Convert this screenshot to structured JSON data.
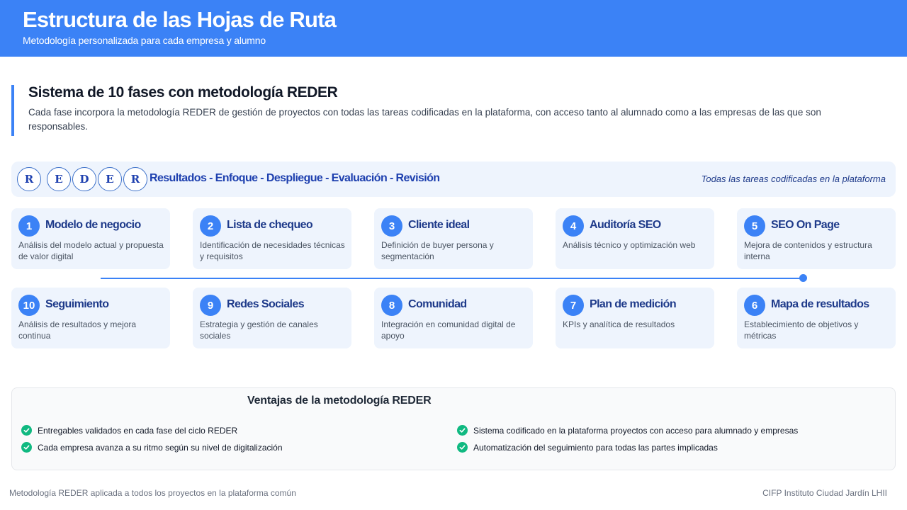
{
  "header": {
    "title": "Estructura de las Hojas de Ruta",
    "subtitle": "Metodología personalizada para cada empresa y alumno"
  },
  "intro": {
    "title": "Sistema de 10 fases con metodología REDER",
    "text": "Cada fase incorpora la metodología REDER de gestión de proyectos con todas las tareas codificadas en la plataforma, con acceso tanto al alumnado como a las empresas de las que son responsables."
  },
  "reder": {
    "letters": [
      "R",
      "E",
      "D",
      "E",
      "R"
    ],
    "label": "Resultados - Enfoque - Despliegue - Evaluación - Revisión",
    "note": "Todas las tareas codificadas en la plataforma"
  },
  "phases": [
    {
      "num": "1",
      "title": "Modelo de negocio",
      "desc": "Análisis del modelo actual y propuesta de valor digital"
    },
    {
      "num": "2",
      "title": "Lista de chequeo",
      "desc": "Identificación de necesidades técnicas y requisitos"
    },
    {
      "num": "3",
      "title": "Cliente ideal",
      "desc": "Definición de buyer persona y segmentación"
    },
    {
      "num": "4",
      "title": "Auditoría SEO",
      "desc": "Análisis técnico y optimización web"
    },
    {
      "num": "5",
      "title": "SEO On Page",
      "desc": "Mejora de contenidos y estructura interna"
    },
    {
      "num": "6",
      "title": "Mapa de resultados",
      "desc": "Establecimiento de objetivos y métricas"
    },
    {
      "num": "7",
      "title": "Plan de medición",
      "desc": "KPIs y analítica de resultados"
    },
    {
      "num": "8",
      "title": "Comunidad",
      "desc": "Integración en comunidad digital de apoyo"
    },
    {
      "num": "9",
      "title": "Redes Sociales",
      "desc": "Estrategia y gestión de canales sociales"
    },
    {
      "num": "10",
      "title": "Seguimiento",
      "desc": "Análisis de resultados y mejora continua"
    }
  ],
  "benefits": {
    "title": "Ventajas de la metodología REDER",
    "items": [
      "Entregables validados en cada fase del ciclo REDER",
      "Cada empresa avanza a su ritmo según su nivel de digitalización",
      "Sistema codificado en la plataforma proyectos con acceso para alumnado y empresas",
      "Automatización del seguimiento para todas las partes implicadas"
    ]
  },
  "footer": {
    "left": "Metodología REDER aplicada a todos los proyectos en la plataforma común",
    "right": "CIFP Instituto Ciudad Jardín LHII"
  },
  "colors": {
    "accent": "#3b82f6",
    "title_blue": "#1e3a8a",
    "card_bg": "#eef4fd",
    "check_green": "#10b981"
  }
}
